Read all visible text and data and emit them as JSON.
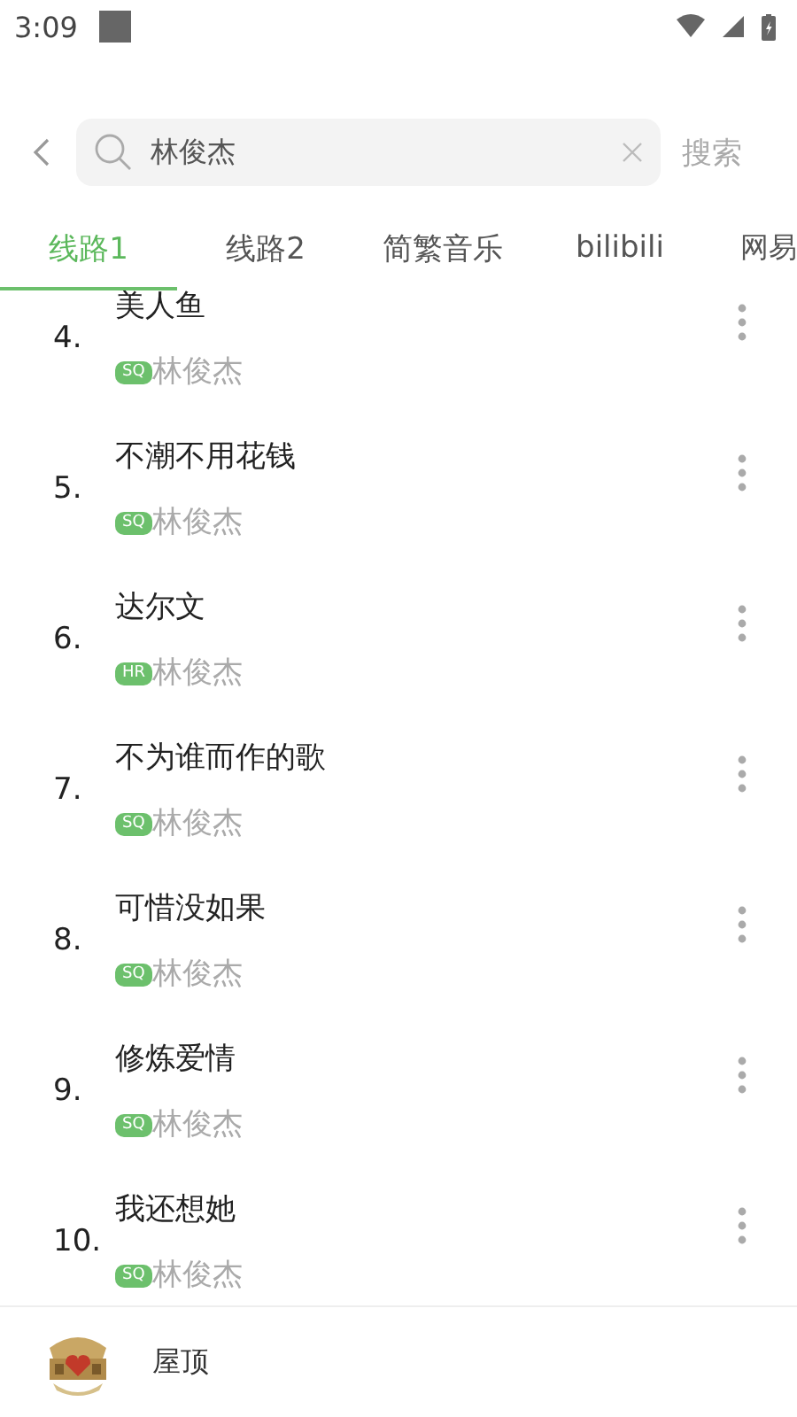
{
  "status_bar": {
    "time": "3:09"
  },
  "search": {
    "value": "林俊杰",
    "submit": "搜索"
  },
  "tabs": [
    {
      "label": "线路1",
      "selected": true
    },
    {
      "label": "线路2",
      "selected": false
    },
    {
      "label": "简繁音乐",
      "selected": false
    },
    {
      "label": "bilibili",
      "selected": false
    },
    {
      "label": "网易",
      "selected": false
    }
  ],
  "songs": [
    {
      "index": "4.",
      "title": "美人鱼",
      "quality": "SQ",
      "artist": "林俊杰"
    },
    {
      "index": "5.",
      "title": "不潮不用花钱",
      "quality": "SQ",
      "artist": "林俊杰"
    },
    {
      "index": "6.",
      "title": "达尔文",
      "quality": "HR",
      "artist": "林俊杰"
    },
    {
      "index": "7.",
      "title": "不为谁而作的歌",
      "quality": "SQ",
      "artist": "林俊杰"
    },
    {
      "index": "8.",
      "title": "可惜没如果",
      "quality": "SQ",
      "artist": "林俊杰"
    },
    {
      "index": "9.",
      "title": "修炼爱情",
      "quality": "SQ",
      "artist": "林俊杰"
    },
    {
      "index": "10.",
      "title": "我还想她",
      "quality": "SQ",
      "artist": "林俊杰"
    }
  ],
  "player": {
    "title": "屋顶"
  }
}
